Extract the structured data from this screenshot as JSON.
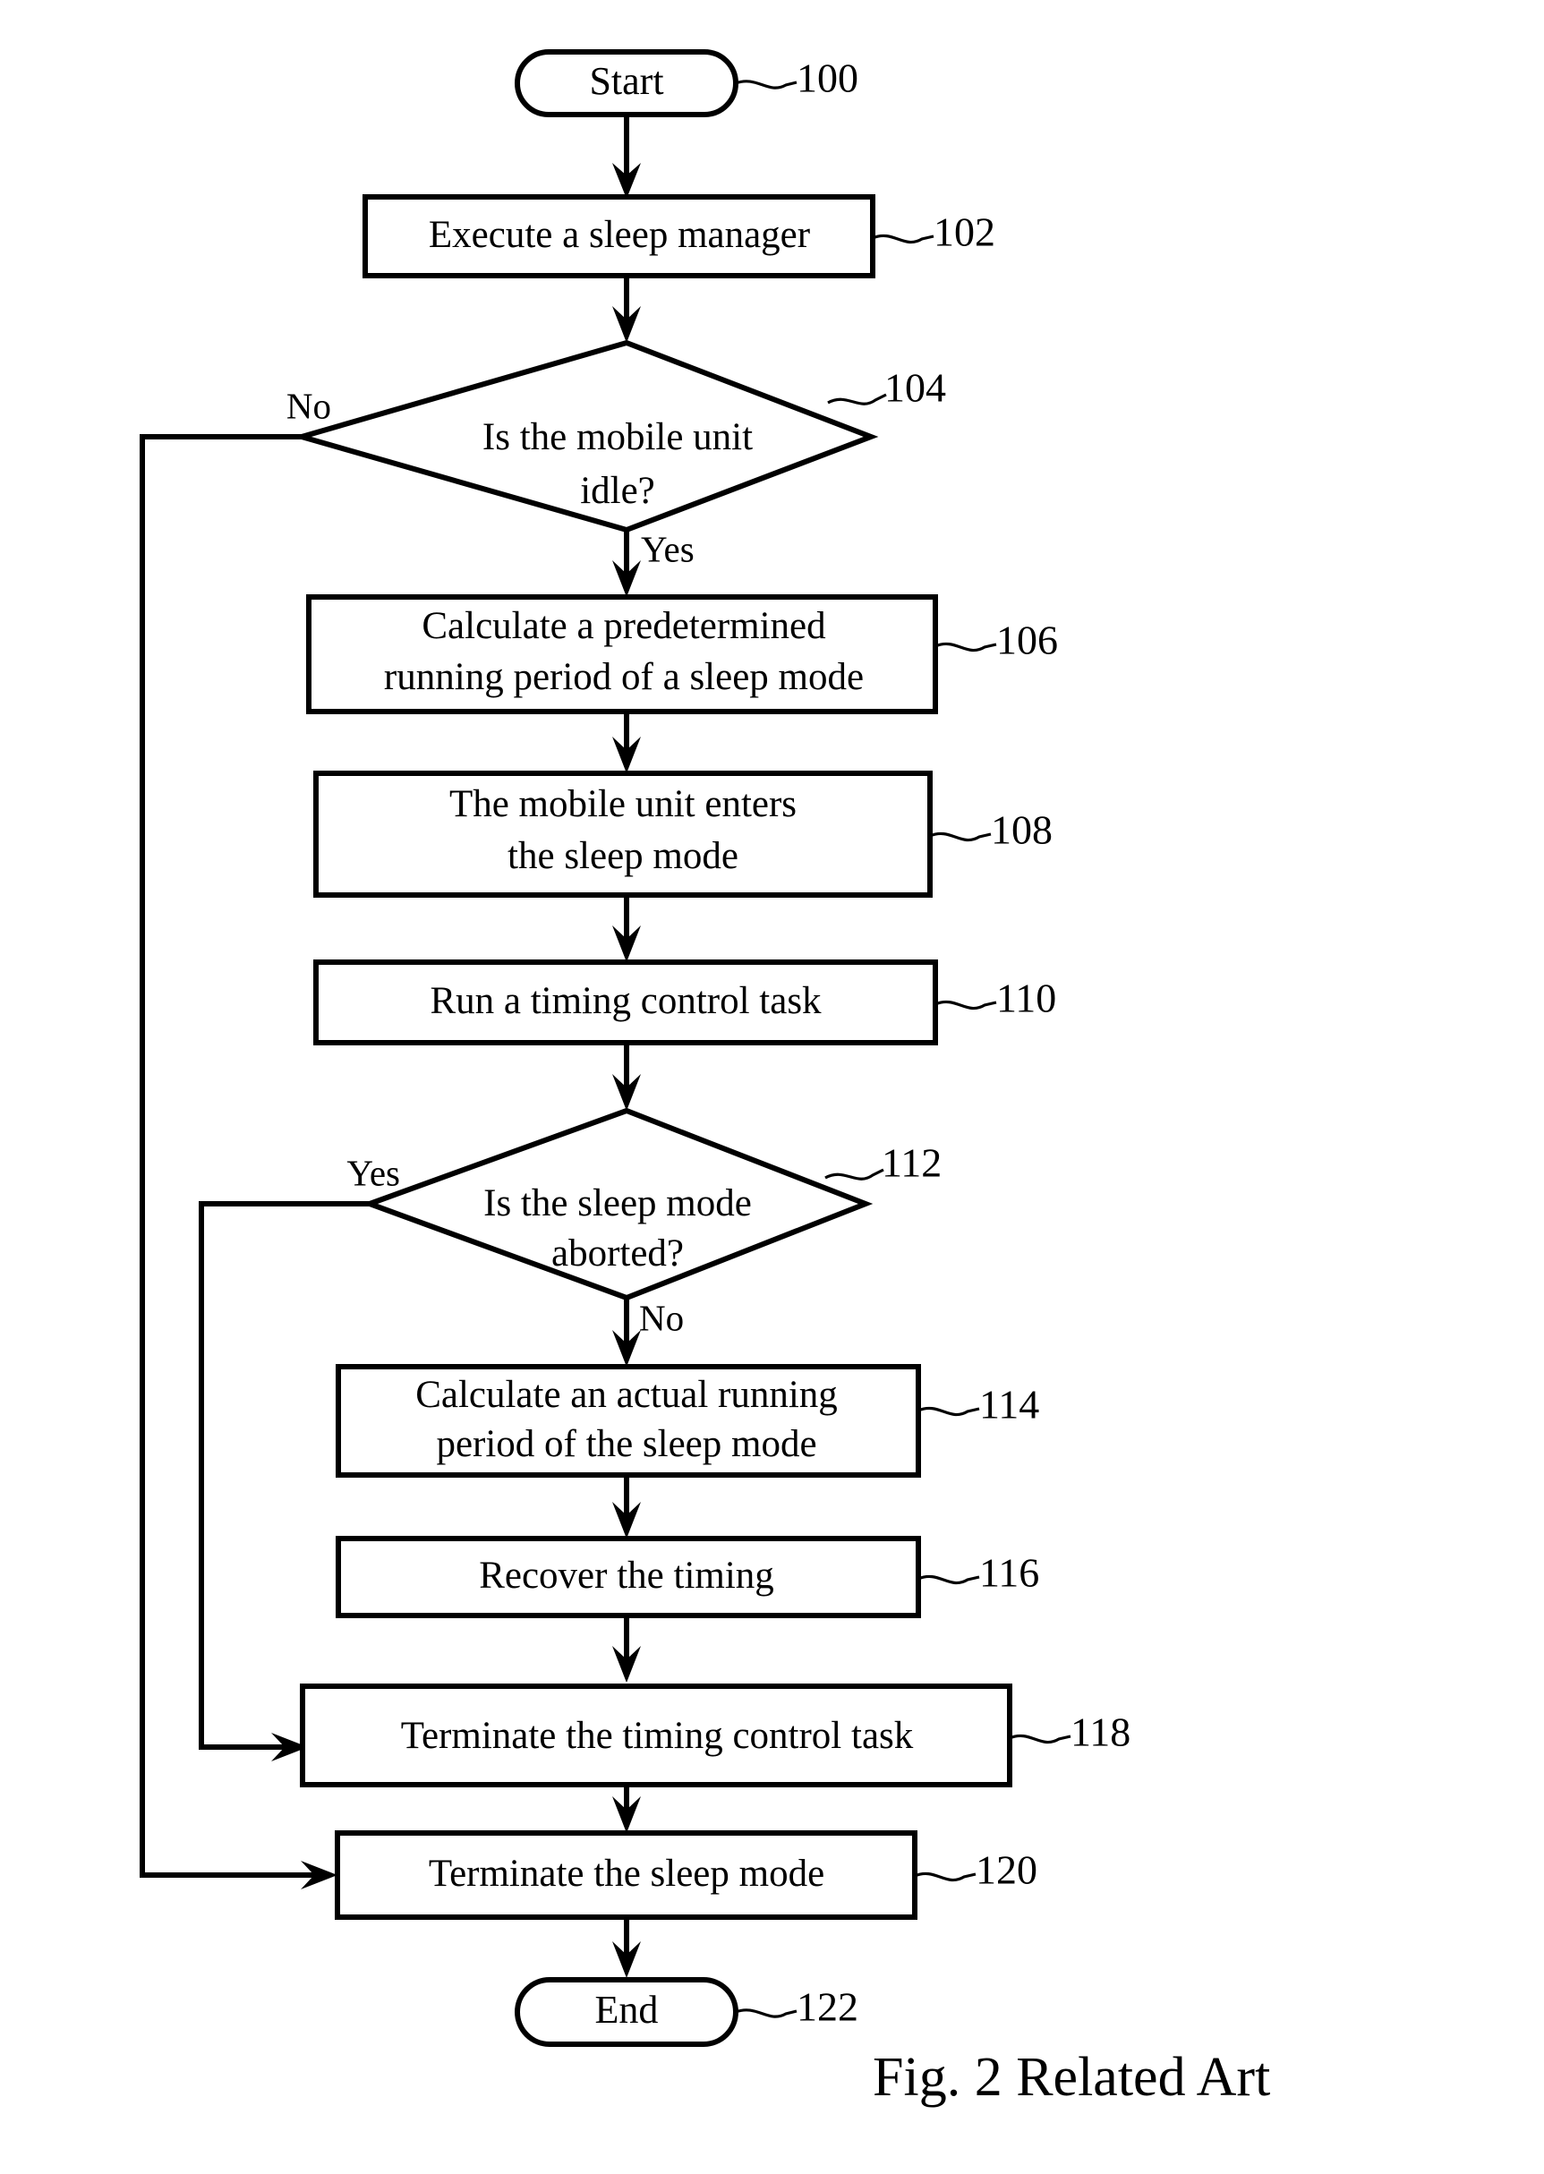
{
  "figure": {
    "caption": "Fig. 2  Related Art"
  },
  "nodes": [
    {
      "id": "start",
      "type": "terminator",
      "label": "Start",
      "ref": "100"
    },
    {
      "id": "n102",
      "type": "process",
      "label": "Execute a sleep manager",
      "ref": "102"
    },
    {
      "id": "n104",
      "type": "decision",
      "label_line1": "Is the mobile unit",
      "label_line2": "idle?",
      "ref": "104"
    },
    {
      "id": "n106",
      "type": "process",
      "label_line1": "Calculate a predetermined",
      "label_line2": "running period of a sleep mode",
      "ref": "106"
    },
    {
      "id": "n108",
      "type": "process",
      "label_line1": "The mobile unit enters",
      "label_line2": "the sleep mode",
      "ref": "108"
    },
    {
      "id": "n110",
      "type": "process",
      "label": "Run a timing control task",
      "ref": "110"
    },
    {
      "id": "n112",
      "type": "decision",
      "label_line1": "Is the sleep mode",
      "label_line2": "aborted?",
      "ref": "112"
    },
    {
      "id": "n114",
      "type": "process",
      "label_line1": "Calculate an actual running",
      "label_line2": "period of the sleep mode",
      "ref": "114"
    },
    {
      "id": "n116",
      "type": "process",
      "label": "Recover the timing",
      "ref": "116"
    },
    {
      "id": "n118",
      "type": "process",
      "label": "Terminate the timing control task",
      "ref": "118"
    },
    {
      "id": "n120",
      "type": "process",
      "label": "Terminate the sleep mode",
      "ref": "120"
    },
    {
      "id": "end",
      "type": "terminator",
      "label": "End",
      "ref": "122"
    }
  ],
  "branch_labels": {
    "d104_no": "No",
    "d104_yes": "Yes",
    "d112_yes": "Yes",
    "d112_no": "No"
  },
  "colors": {
    "stroke": "#000000",
    "fill": "#ffffff",
    "text": "#000000"
  },
  "chart_data": {
    "type": "diagram",
    "title": "Fig. 2  Related Art",
    "flow": [
      {
        "from": "100 Start",
        "to": "102 Execute a sleep manager",
        "label": ""
      },
      {
        "from": "102 Execute a sleep manager",
        "to": "104 Is the mobile unit idle?",
        "label": ""
      },
      {
        "from": "104 Is the mobile unit idle?",
        "to": "120 Terminate the sleep mode",
        "label": "No"
      },
      {
        "from": "104 Is the mobile unit idle?",
        "to": "106 Calculate a predetermined running period of a sleep mode",
        "label": "Yes"
      },
      {
        "from": "106 Calculate a predetermined running period of a sleep mode",
        "to": "108 The mobile unit enters the sleep mode",
        "label": ""
      },
      {
        "from": "108 The mobile unit enters the sleep mode",
        "to": "110 Run a timing control task",
        "label": ""
      },
      {
        "from": "110 Run a timing control task",
        "to": "112 Is the sleep mode aborted?",
        "label": ""
      },
      {
        "from": "112 Is the sleep mode aborted?",
        "to": "118 Terminate the timing control task",
        "label": "Yes"
      },
      {
        "from": "112 Is the sleep mode aborted?",
        "to": "114 Calculate an actual running period of the sleep mode",
        "label": "No"
      },
      {
        "from": "114 Calculate an actual running period of the sleep mode",
        "to": "116 Recover the timing",
        "label": ""
      },
      {
        "from": "116 Recover the timing",
        "to": "118 Terminate the timing control task",
        "label": ""
      },
      {
        "from": "118 Terminate the timing control task",
        "to": "120 Terminate the sleep mode",
        "label": ""
      },
      {
        "from": "120 Terminate the sleep mode",
        "to": "122 End",
        "label": ""
      }
    ]
  }
}
